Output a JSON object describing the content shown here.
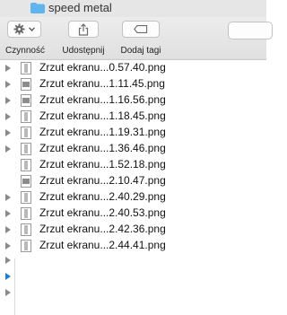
{
  "window": {
    "title": "speed metal"
  },
  "toolbar": {
    "action_label": "Czynność",
    "share_label": "Udostępnij",
    "tags_label": "Dodaj tagi"
  },
  "files": [
    {
      "name": "Zrzut ekranu...0.57.40.png",
      "icon": "portrait-image-icon"
    },
    {
      "name": "Zrzut ekranu...1.11.45.png",
      "icon": "landscape-image-icon"
    },
    {
      "name": "Zrzut ekranu...1.16.56.png",
      "icon": "landscape-image-icon"
    },
    {
      "name": "Zrzut ekranu...1.18.45.png",
      "icon": "portrait-image-icon"
    },
    {
      "name": "Zrzut ekranu...1.19.31.png",
      "icon": "portrait-image-icon"
    },
    {
      "name": "Zrzut ekranu...1.36.46.png",
      "icon": "portrait-image-icon"
    },
    {
      "name": "Zrzut ekranu...1.52.18.png",
      "icon": "portrait-image-icon"
    },
    {
      "name": "Zrzut ekranu...2.10.47.png",
      "icon": "landscape-image-icon"
    },
    {
      "name": "Zrzut ekranu...2.40.29.png",
      "icon": "portrait-image-icon"
    },
    {
      "name": "Zrzut ekranu...2.40.53.png",
      "icon": "portrait-image-icon"
    },
    {
      "name": "Zrzut ekranu...2.42.36.png",
      "icon": "portrait-image-icon"
    },
    {
      "name": "Zrzut ekranu...2.44.41.png",
      "icon": "portrait-image-icon"
    }
  ],
  "colors": {
    "accent": "#1b7fd6",
    "folder": "#5fb3ef"
  }
}
